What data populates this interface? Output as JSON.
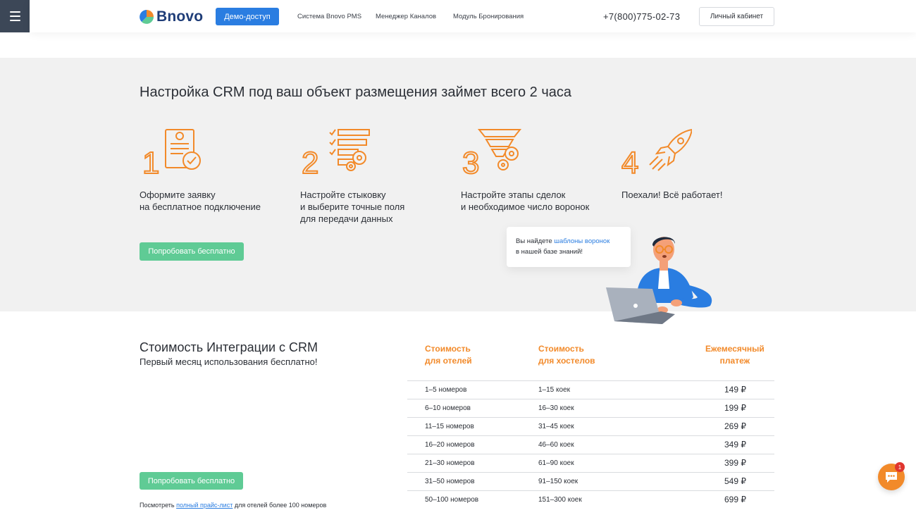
{
  "header": {
    "logo_text": "Bnovo",
    "demo_label": "Демо-доступ",
    "nav": [
      "Система Bnovo PMS",
      "Менеджер Каналов",
      "Модуль Бронирования"
    ],
    "phone": "+7(800)775-02-73",
    "cabinet_label": "Личный кабинет"
  },
  "steps": {
    "title": "Настройка CRM под ваш объект размещения займет всего 2 часа",
    "items": [
      {
        "text": "Оформите заявку\nна бесплатное подключение"
      },
      {
        "text": "Настройте стыковку\nи выберите точные поля\nдля передачи данных"
      },
      {
        "text": "Настройте этапы сделок\nи необходимое число воронок"
      },
      {
        "text": "Поехали! Всё работает!"
      }
    ],
    "try_label": "Попробовать бесплатно",
    "speech_prefix": "Вы найдете ",
    "speech_link": "шаблоны воронок",
    "speech_suffix": "в нашей базе знаний!"
  },
  "pricing": {
    "title": "Стоимость Интеграции с CRM",
    "subtitle": "Первый месяц использования бесплатно!",
    "try_label": "Попробовать бесплатно",
    "note_prefix": "Посмотреть ",
    "note_link": "полный прайс-лист",
    "note_suffix": " для отелей более 100 номеров",
    "headers": [
      "Стоимость\nдля отелей",
      "Стоимость\nдля хостелов",
      "Ежемесячный\nплатеж"
    ],
    "rows": [
      [
        "1–5 номеров",
        "1–15 коек",
        "149 ₽"
      ],
      [
        "6–10 номеров",
        "16–30 коек",
        "199 ₽"
      ],
      [
        "11–15 номеров",
        "31–45 коек",
        "269 ₽"
      ],
      [
        "16–20 номеров",
        "46–60 коек",
        "349 ₽"
      ],
      [
        "21–30 номеров",
        "61–90 коек",
        "399 ₽"
      ],
      [
        "31–50 номеров",
        "91–150 коек",
        "549 ₽"
      ],
      [
        "50–100 номеров",
        "151–300 коек",
        "699 ₽"
      ]
    ]
  },
  "chat": {
    "badge": "1"
  },
  "colors": {
    "accent_orange": "#f28a2a",
    "accent_blue": "#2a7de1",
    "accent_green": "#5fcb95",
    "menu_bg": "#3c4757"
  }
}
